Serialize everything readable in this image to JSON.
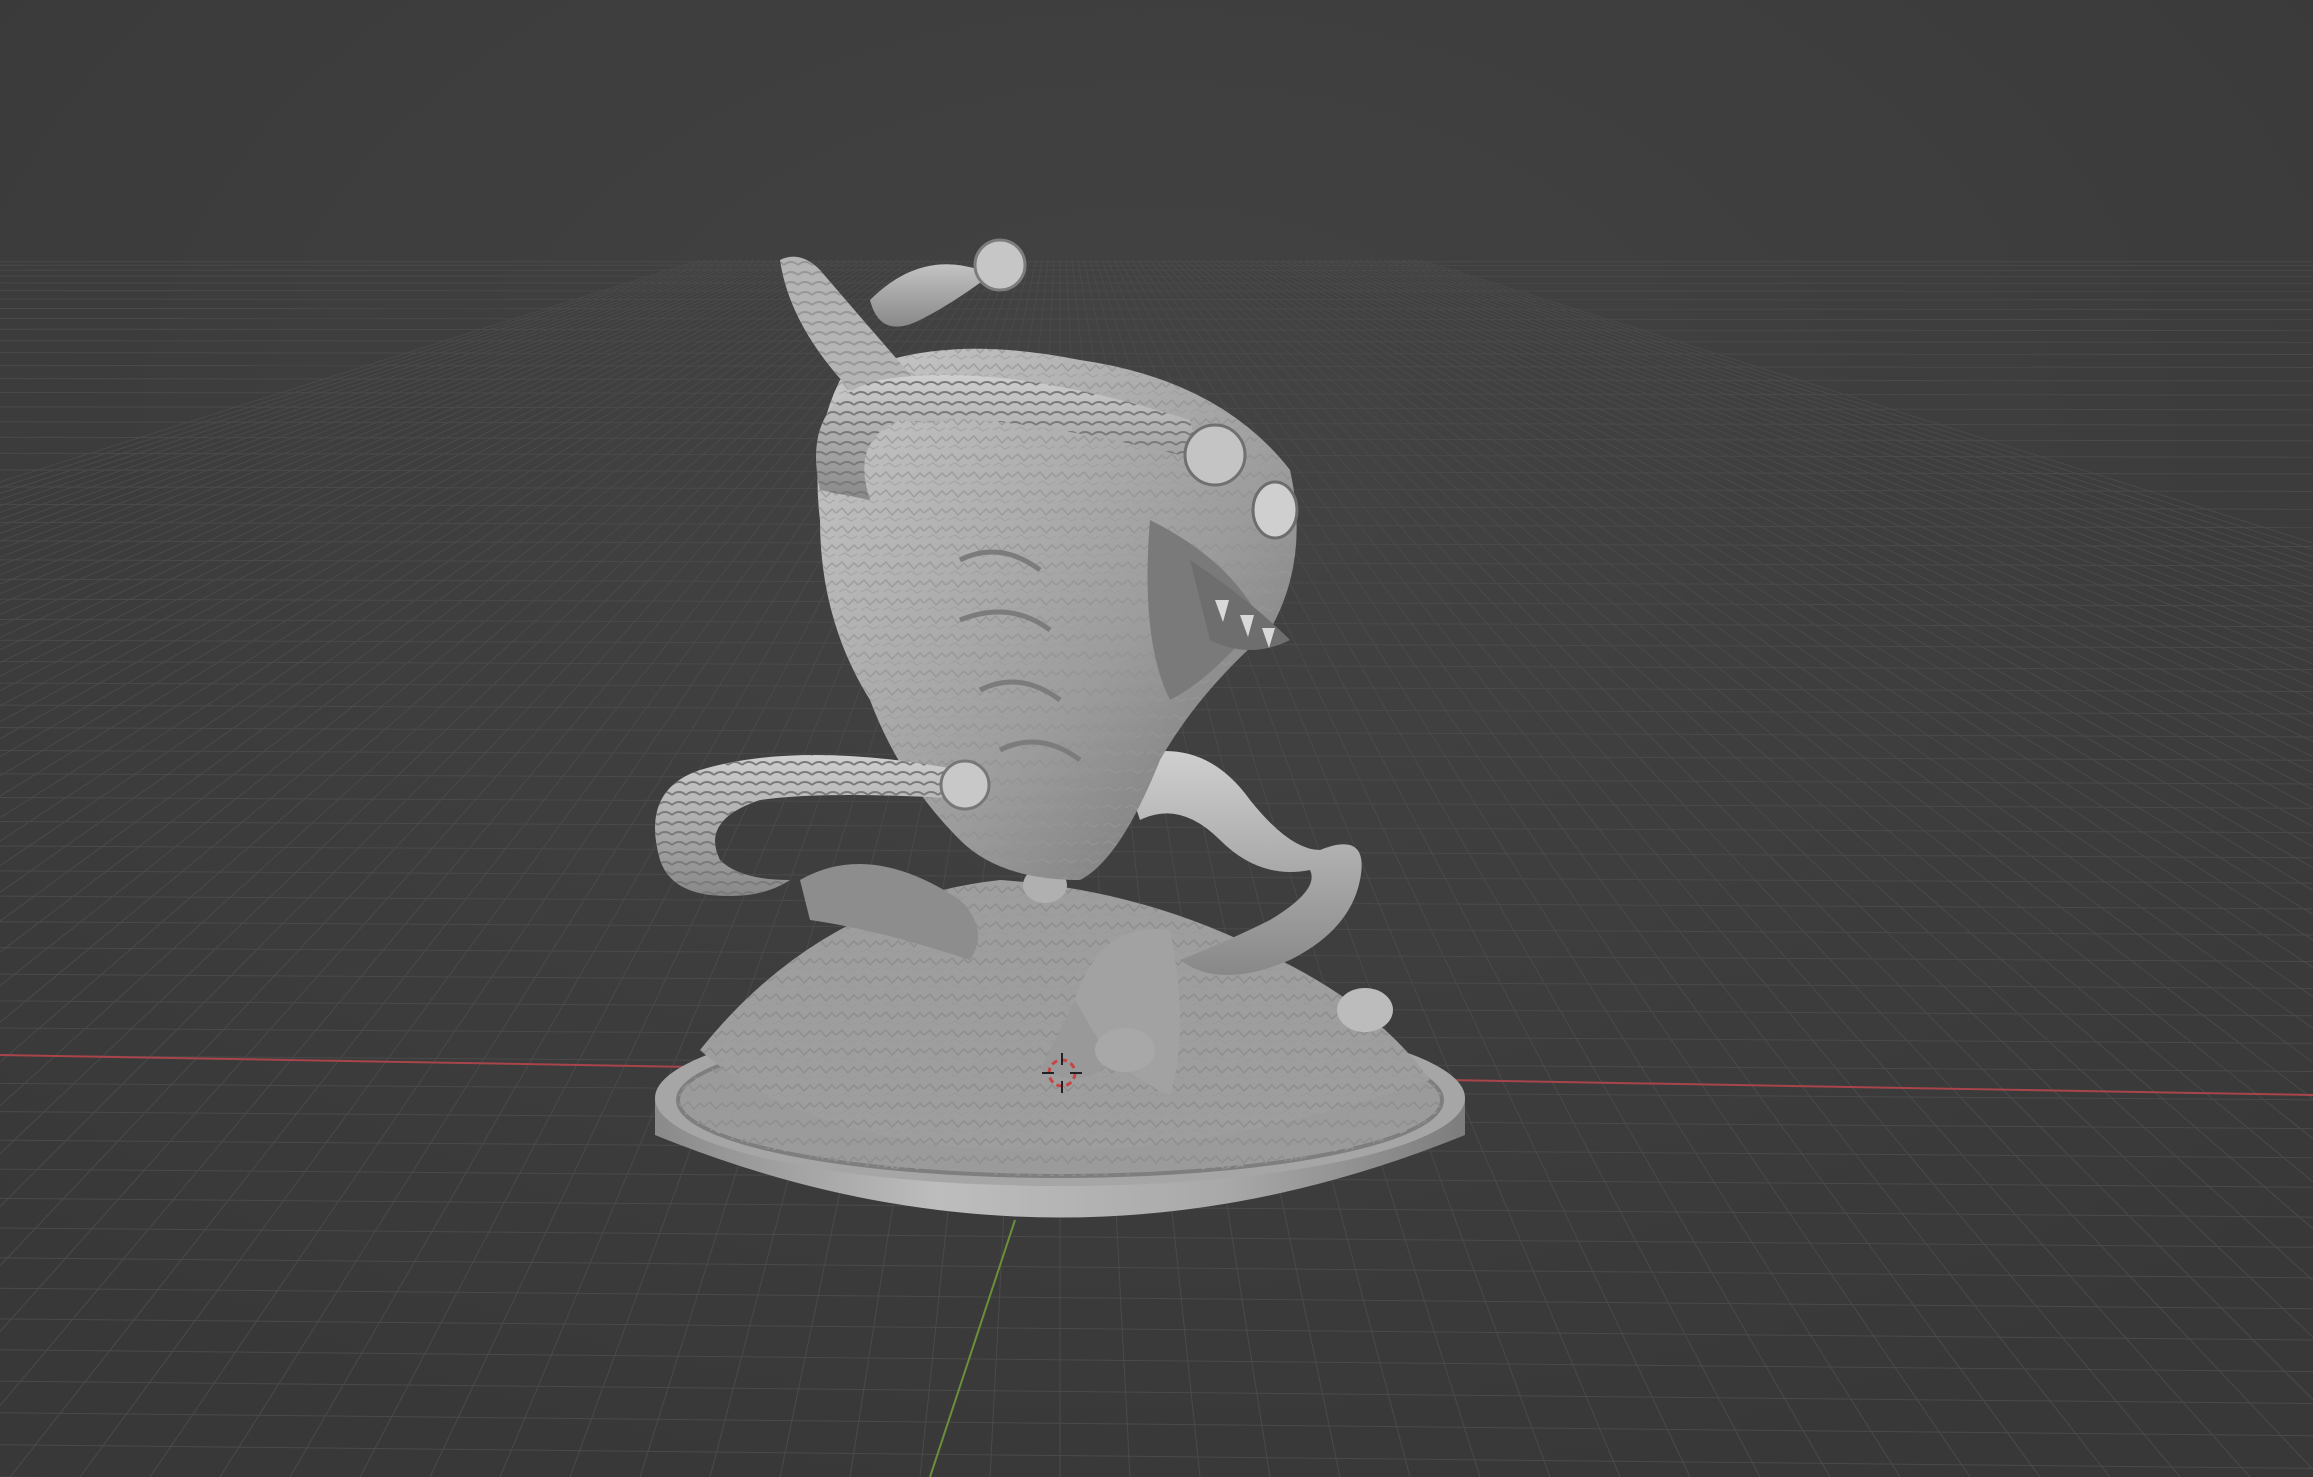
{
  "app": {
    "view": "3D Viewport"
  },
  "viewport": {
    "background_color": "#3d3d3d",
    "grid": {
      "visible": true,
      "line_color": "#4a4a4a"
    },
    "axes": {
      "x_axis_color": "#a8444a",
      "y_axis_color": "#6b8f3a"
    },
    "object": {
      "name_icon": "sculpted-creature-miniature",
      "base_shape": "round-base",
      "material_color": "#b9b9b9"
    },
    "cursor_3d": {
      "icon": "3d-cursor-icon",
      "ring_color": "#c84444"
    }
  }
}
